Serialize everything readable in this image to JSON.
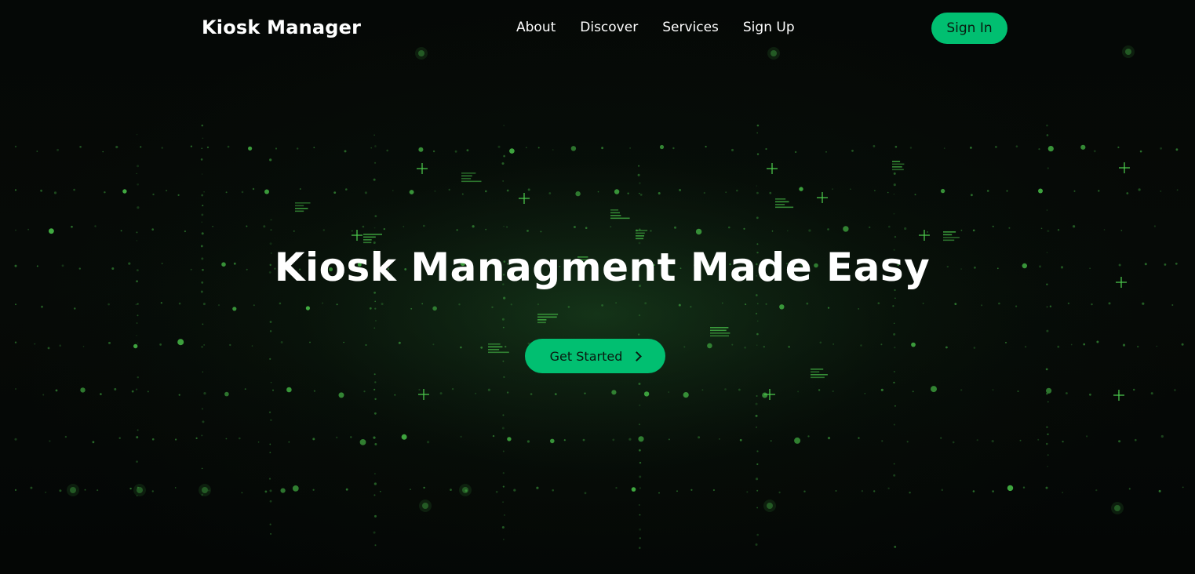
{
  "header": {
    "brand": "Kiosk Manager",
    "nav": [
      {
        "label": "About"
      },
      {
        "label": "Discover"
      },
      {
        "label": "Services"
      },
      {
        "label": "Sign Up"
      }
    ],
    "signin_label": "Sign In"
  },
  "hero": {
    "title": "Kiosk Managment Made Easy",
    "cta_label": "Get Started",
    "cta_icon": "chevron-right-icon"
  },
  "colors": {
    "accent": "#01bf71",
    "background": "#050806",
    "particle": "#4cc94c",
    "text": "#ffffff"
  }
}
